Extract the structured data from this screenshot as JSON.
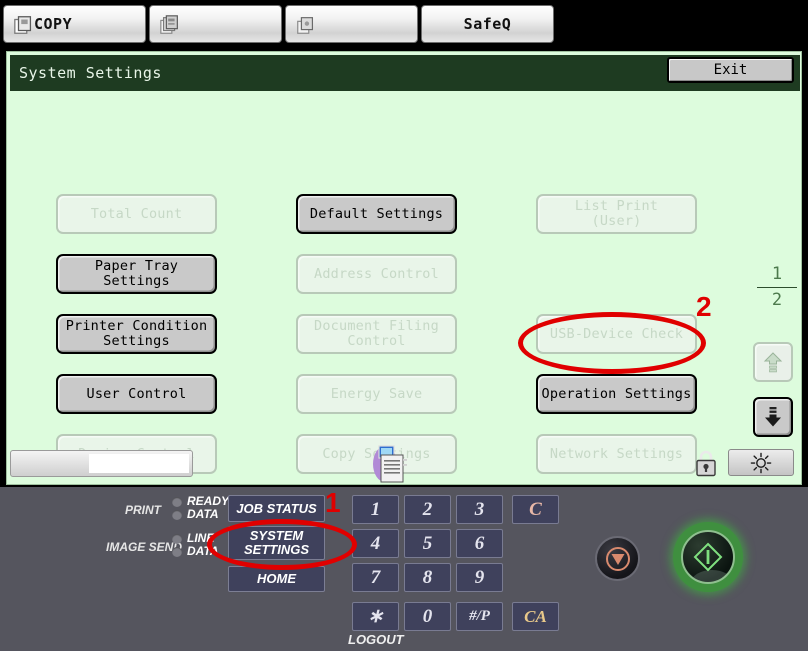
{
  "tabs": [
    {
      "label": "COPY",
      "icon": "copy-icon"
    },
    {
      "label": "",
      "icon": "documents-icon"
    },
    {
      "label": "",
      "icon": "scan-icon"
    },
    {
      "label": "SafeQ",
      "icon": ""
    }
  ],
  "lcd": {
    "title": "System Settings",
    "exit_label": "Exit",
    "page_current": "1",
    "page_total": "2",
    "buttons": [
      {
        "label": "Total Count",
        "enabled": false,
        "col": 1,
        "row": 1
      },
      {
        "label": "Paper Tray\nSettings",
        "enabled": true,
        "col": 1,
        "row": 2
      },
      {
        "label": "Printer Condition\nSettings",
        "enabled": true,
        "col": 1,
        "row": 3
      },
      {
        "label": "User Control",
        "enabled": true,
        "col": 1,
        "row": 4
      },
      {
        "label": "Device Control",
        "enabled": false,
        "col": 1,
        "row": 5
      },
      {
        "label": "Default Settings",
        "enabled": true,
        "col": 2,
        "row": 1
      },
      {
        "label": "Address Control",
        "enabled": false,
        "col": 2,
        "row": 2
      },
      {
        "label": "Document Filing\nControl",
        "enabled": false,
        "col": 2,
        "row": 3
      },
      {
        "label": "Energy Save",
        "enabled": false,
        "col": 2,
        "row": 4
      },
      {
        "label": "Copy Settings",
        "enabled": false,
        "col": 2,
        "row": 5
      },
      {
        "label": "List Print\n(User)",
        "enabled": false,
        "col": 3,
        "row": 1
      },
      {
        "label": "USB-Device Check",
        "enabled": false,
        "col": 3,
        "row": 3
      },
      {
        "label": "Operation Settings",
        "enabled": true,
        "col": 3,
        "row": 4
      },
      {
        "label": "Network Settings",
        "enabled": false,
        "col": 3,
        "row": 5
      }
    ],
    "scroll_up_enabled": false,
    "scroll_down_enabled": true
  },
  "statusbar": {
    "printer_icon": "printer-icon",
    "lock_icon": "lock-icon",
    "brightness_icon": "brightness-sun-icon"
  },
  "panel": {
    "print_label": "PRINT",
    "image_send_label": "IMAGE SEND",
    "led_labels": [
      "READY",
      "DATA",
      "LINE",
      "DATA"
    ],
    "buttons": [
      {
        "label": "JOB STATUS"
      },
      {
        "label": "SYSTEM\nSETTINGS"
      },
      {
        "label": "HOME"
      }
    ],
    "keypad": [
      "1",
      "2",
      "3",
      "4",
      "5",
      "6",
      "7",
      "8",
      "9",
      "∗",
      "0",
      "#/P"
    ],
    "clear_label": "C",
    "clear_all_label": "CA",
    "logout_label": "LOGOUT",
    "stop_icon": "stop-icon",
    "start_icon": "start-icon"
  },
  "annotations": [
    {
      "number": "1",
      "target": "system-settings-hard-key"
    },
    {
      "number": "2",
      "target": "operation-settings-button"
    }
  ],
  "colors": {
    "lcd_background": "#ddfcdd",
    "titlebar": "#1e3b21",
    "panel": "#55555e",
    "annotation_red": "#e00000",
    "start_green": "#3f8f3f"
  }
}
